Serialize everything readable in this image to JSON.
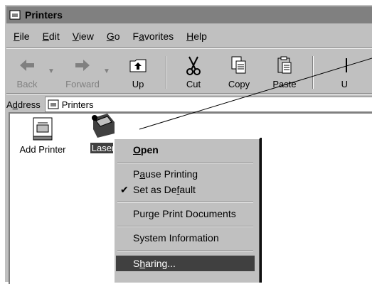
{
  "window": {
    "title": "Printers"
  },
  "menubar": [
    "File",
    "Edit",
    "View",
    "Go",
    "Favorites",
    "Help"
  ],
  "toolbar": {
    "back": "Back",
    "forward": "Forward",
    "up": "Up",
    "cut": "Cut",
    "copy": "Copy",
    "paste": "Paste",
    "partial": "U"
  },
  "address": {
    "label": "Address",
    "value": "Printers"
  },
  "items": {
    "add_printer": "Add Printer",
    "laser": "Laser"
  },
  "context_menu": {
    "open": "Open",
    "pause": "Pause Printing",
    "set_default": "Set as Default",
    "purge": "Purge Print Documents",
    "sysinfo": "System Information",
    "sharing": "Sharing..."
  },
  "colors": {
    "face": "#c0c0c0",
    "shadow": "#808080",
    "highlight": "#404040"
  }
}
